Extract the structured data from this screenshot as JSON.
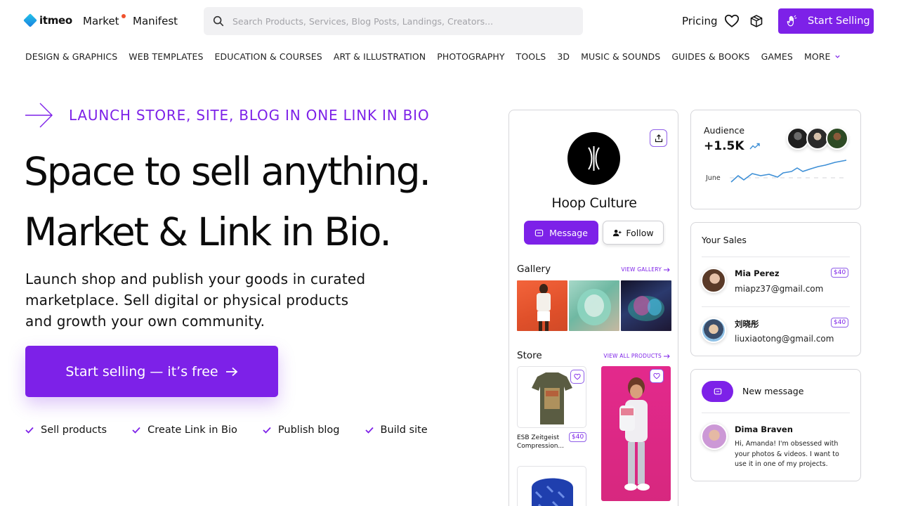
{
  "header": {
    "logo_text": "itmeo",
    "nav": [
      {
        "label": "Market",
        "has_dot": true
      },
      {
        "label": "Manifest"
      }
    ],
    "search": {
      "placeholder": "Search Products, Services, Blog Posts, Landings, Creators..."
    },
    "pricing_label": "Pricing",
    "start_selling_label": "Start Selling",
    "accent_color": "#7d21e8",
    "dot_color": "#f0522d"
  },
  "categories": [
    "DESIGN & GRAPHICS",
    "WEB TEMPLATES",
    "EDUCATION & COURSES",
    "ART & ILLUSTRATION",
    "PHOTOGRAPHY",
    "TOOLS",
    "3D",
    "MUSIC & SOUNDS",
    "GUIDES & BOOKS",
    "GAMES",
    "MORE"
  ],
  "hero": {
    "eyebrow": "LAUNCH STORE, SITE, BLOG IN ONE LINK IN BIO",
    "headline_1": "Space to sell anything.",
    "headline_2": "Market & Link in Bio.",
    "lead": "Launch shop and publish your goods in curated marketplace. Sell digital or physical products and growth your own community.",
    "cta": "Start selling — it’s free",
    "features": [
      "Sell products",
      "Create Link in Bio",
      "Publish blog",
      "Build site"
    ]
  },
  "profile": {
    "name": "Hoop Culture",
    "message_label": "Message",
    "follow_label": "Follow",
    "gallery_title": "Gallery",
    "gallery_link": "VIEW GALLERY",
    "store_title": "Store",
    "store_link": "VIEW ALL PRODUCTS",
    "product_1_name": "ESB Zeitgeist Compression...",
    "product_1_price": "$40"
  },
  "audience": {
    "label": "Audience",
    "value": "+1.5K",
    "month": "June"
  },
  "sales": {
    "title": "Your Sales",
    "buyers": [
      {
        "name": "Mia Perez",
        "email": "miapz37@gmail.com",
        "price": "$40"
      },
      {
        "name": "刘晓彤",
        "email": "liuxiaotong@gmail.com",
        "price": "$40"
      }
    ]
  },
  "message": {
    "label": "New message",
    "sender": "Dima Braven",
    "text": "Hi, Amanda! I'm obsessed with your photos & videos. I want to use it in one of my projects."
  }
}
